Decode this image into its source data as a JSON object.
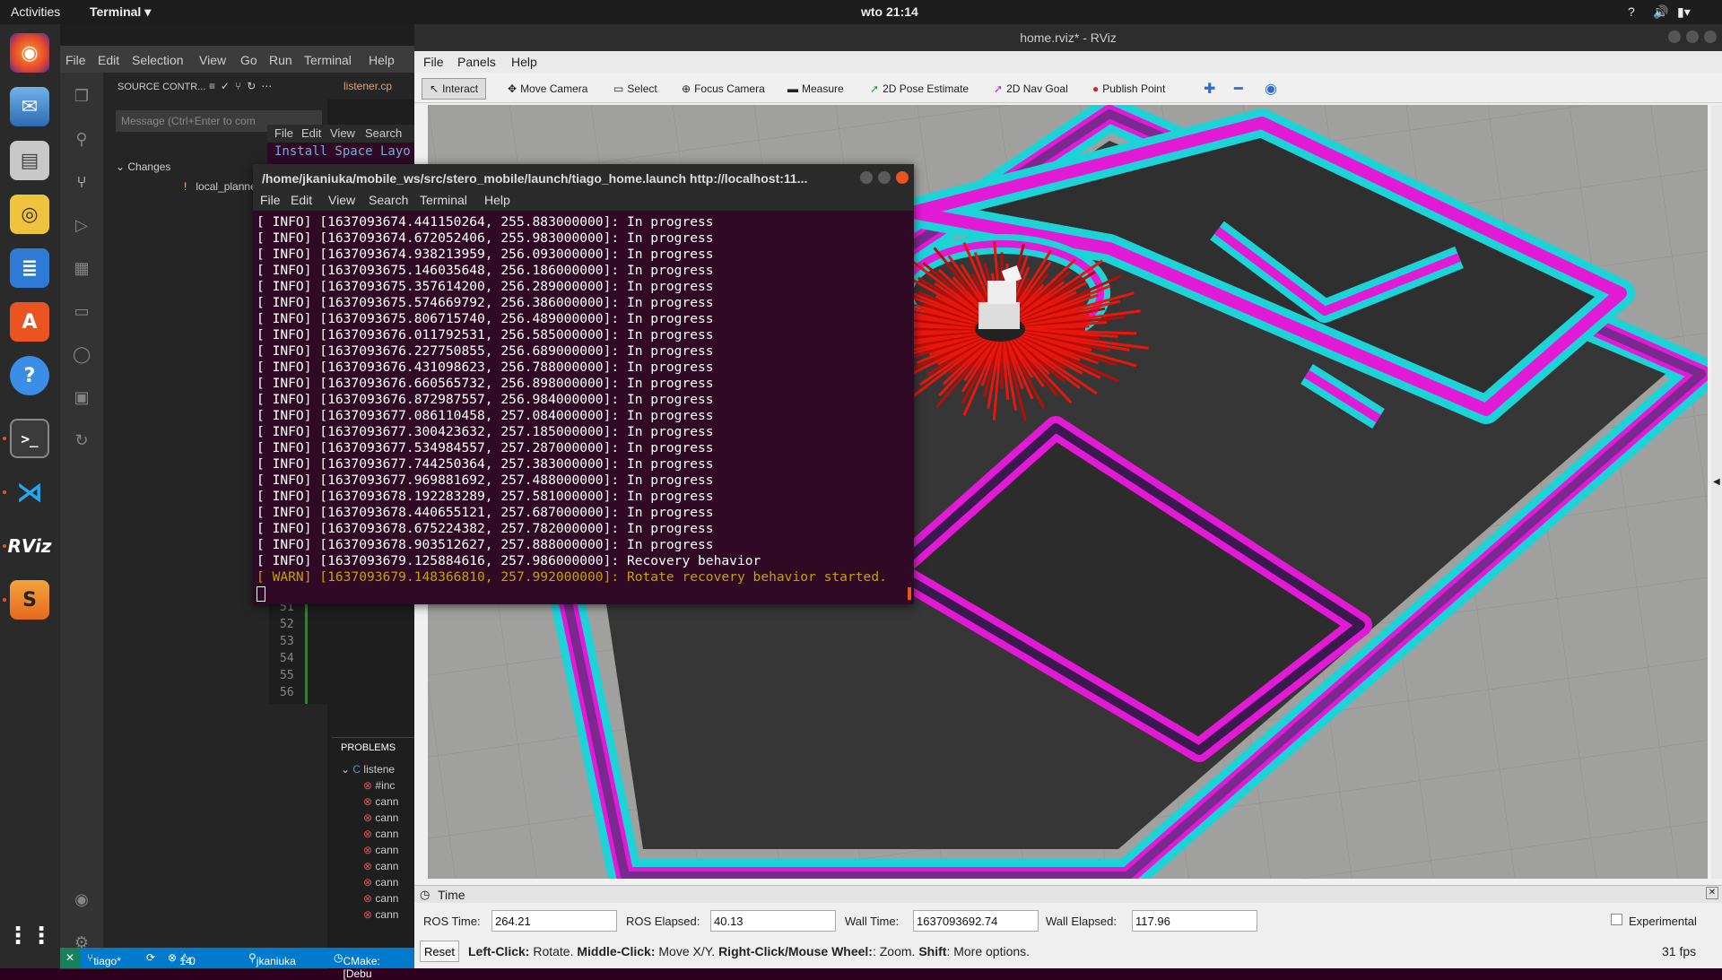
{
  "topbar": {
    "activities": "Activities",
    "app": "Terminal ▾",
    "clock": "wto 21:14"
  },
  "vscode": {
    "menu": [
      "File",
      "Edit",
      "Selection",
      "View",
      "Go",
      "Run",
      "Terminal",
      "Help"
    ],
    "source_control": "SOURCE CONTR...",
    "tab": "listener.cp",
    "message_placeholder": "Message (Ctrl+Enter to com",
    "changes": "Changes",
    "file": "local_planner_params.ya",
    "bg_term_menu": [
      "File",
      "Edit",
      "View",
      "Search"
    ],
    "bg_term_text": "Install Space Layo",
    "line_numbers": [
      "51",
      "52",
      "53",
      "54",
      "55",
      "56"
    ],
    "problems": "PROBLEMS",
    "problem_file": "listene",
    "problem_items": [
      "#inc",
      "cann",
      "cann",
      "cann",
      "cann",
      "cann",
      "cann",
      "cann",
      "cann"
    ],
    "status": {
      "branch": "tiago*",
      "errors": "14",
      "warnings": "0",
      "user": "jkaniuka",
      "cmake": "CMake: [Debu"
    }
  },
  "rviz": {
    "title": "home.rviz* - RViz",
    "menu": [
      "File",
      "Panels",
      "Help"
    ],
    "tools": [
      "Interact",
      "Move Camera",
      "Select",
      "Focus Camera",
      "Measure",
      "2D Pose Estimate",
      "2D Nav Goal",
      "Publish Point"
    ],
    "time": {
      "panel_title": "Time",
      "ros_time_label": "ROS Time:",
      "ros_time": "264.21",
      "ros_elapsed_label": "ROS Elapsed:",
      "ros_elapsed": "40.13",
      "wall_time_label": "Wall Time:",
      "wall_time": "1637093692.74",
      "wall_elapsed_label": "Wall Elapsed:",
      "wall_elapsed": "117.96",
      "experimental": "Experimental",
      "reset": "Reset",
      "hint_parts": [
        "Left-Click:",
        " Rotate. ",
        "Middle-Click:",
        " Move X/Y. ",
        "Right-Click/Mouse Wheel:",
        ": Zoom. ",
        "Shift",
        ": More options."
      ],
      "fps": "31 fps"
    }
  },
  "terminal": {
    "title": "/home/jkaniuka/mobile_ws/src/stero_mobile/launch/tiago_home.launch http://localhost:11...",
    "menu": [
      "File",
      "Edit",
      "View",
      "Search",
      "Terminal",
      "Help"
    ],
    "lines": [
      "[ INFO] [1637093674.441150264, 255.883000000]: In progress",
      "[ INFO] [1637093674.672052406, 255.983000000]: In progress",
      "[ INFO] [1637093674.938213959, 256.093000000]: In progress",
      "[ INFO] [1637093675.146035648, 256.186000000]: In progress",
      "[ INFO] [1637093675.357614200, 256.289000000]: In progress",
      "[ INFO] [1637093675.574669792, 256.386000000]: In progress",
      "[ INFO] [1637093675.806715740, 256.489000000]: In progress",
      "[ INFO] [1637093676.011792531, 256.585000000]: In progress",
      "[ INFO] [1637093676.227750855, 256.689000000]: In progress",
      "[ INFO] [1637093676.431098623, 256.788000000]: In progress",
      "[ INFO] [1637093676.660565732, 256.898000000]: In progress",
      "[ INFO] [1637093676.872987557, 256.984000000]: In progress",
      "[ INFO] [1637093677.086110458, 257.084000000]: In progress",
      "[ INFO] [1637093677.300423632, 257.185000000]: In progress",
      "[ INFO] [1637093677.534984557, 257.287000000]: In progress",
      "[ INFO] [1637093677.744250364, 257.383000000]: In progress",
      "[ INFO] [1637093677.969881692, 257.488000000]: In progress",
      "[ INFO] [1637093678.192283289, 257.581000000]: In progress",
      "[ INFO] [1637093678.440655121, 257.687000000]: In progress",
      "[ INFO] [1637093678.675224382, 257.782000000]: In progress",
      "[ INFO] [1637093678.903512627, 257.888000000]: In progress",
      "[ INFO] [1637093679.125884616, 257.986000000]: Recovery behavior"
    ],
    "warn_line": "[ WARN] [1637093679.148366810, 257.992000000]: Rotate recovery behavior started."
  }
}
